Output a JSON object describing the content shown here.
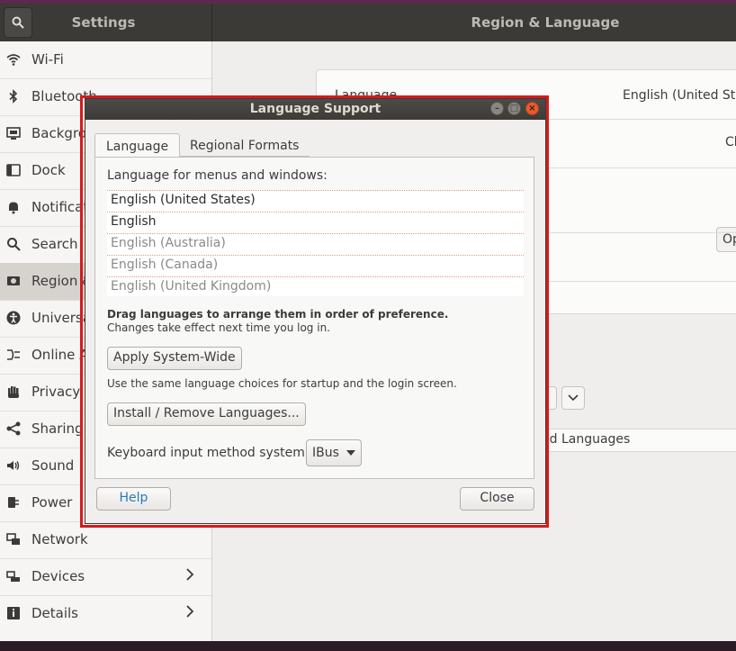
{
  "settings": {
    "search_icon": "search-icon",
    "left_title": "Settings",
    "right_title": "Region & Language",
    "sidebar": [
      {
        "label": "Wi-Fi",
        "icon": "wifi-icon"
      },
      {
        "label": "Bluetooth",
        "icon": "bluetooth-icon"
      },
      {
        "label": "Background",
        "icon": "background-icon"
      },
      {
        "label": "Dock",
        "icon": "dock-icon"
      },
      {
        "label": "Notifications",
        "icon": "bell-icon"
      },
      {
        "label": "Search",
        "icon": "search-icon"
      },
      {
        "label": "Region & Language",
        "icon": "region-icon",
        "selected": true
      },
      {
        "label": "Universal Access",
        "icon": "accessibility-icon"
      },
      {
        "label": "Online Accounts",
        "icon": "online-accounts-icon"
      },
      {
        "label": "Privacy",
        "icon": "hand-icon"
      },
      {
        "label": "Sharing",
        "icon": "share-icon"
      },
      {
        "label": "Sound",
        "icon": "speaker-icon"
      },
      {
        "label": "Power",
        "icon": "power-icon"
      },
      {
        "label": "Network",
        "icon": "network-icon"
      },
      {
        "label": "Devices",
        "icon": "devices-icon",
        "chevron": true
      },
      {
        "label": "Details",
        "icon": "details-icon",
        "chevron": true
      }
    ],
    "content": {
      "language_label": "Language",
      "language_value": "English (United States)",
      "formats_value_partial": "Ch",
      "options_button_partial": "Op",
      "installed_languages_partial": "ed Languages"
    }
  },
  "dialog": {
    "title": "Language Support",
    "tabs": [
      {
        "label": "Language",
        "active": true
      },
      {
        "label": "Regional Formats",
        "active": false
      }
    ],
    "menus_label": "Language for menus and windows:",
    "languages": [
      {
        "name": "English (United States)",
        "active": true
      },
      {
        "name": "English",
        "active": true
      },
      {
        "name": "English (Australia)",
        "active": false
      },
      {
        "name": "English (Canada)",
        "active": false
      },
      {
        "name": "English (United Kingdom)",
        "active": false
      }
    ],
    "drag_hint": "Drag languages to arrange them in order of preference.",
    "login_hint": "Changes take effect next time you log in.",
    "apply_button": "Apply System-Wide",
    "apply_note": "Use the same language choices for startup and the login screen.",
    "install_button": "Install / Remove Languages...",
    "keyboard_label": "Keyboard input method system:",
    "keyboard_value": "IBus",
    "help_button": "Help",
    "close_button": "Close"
  }
}
